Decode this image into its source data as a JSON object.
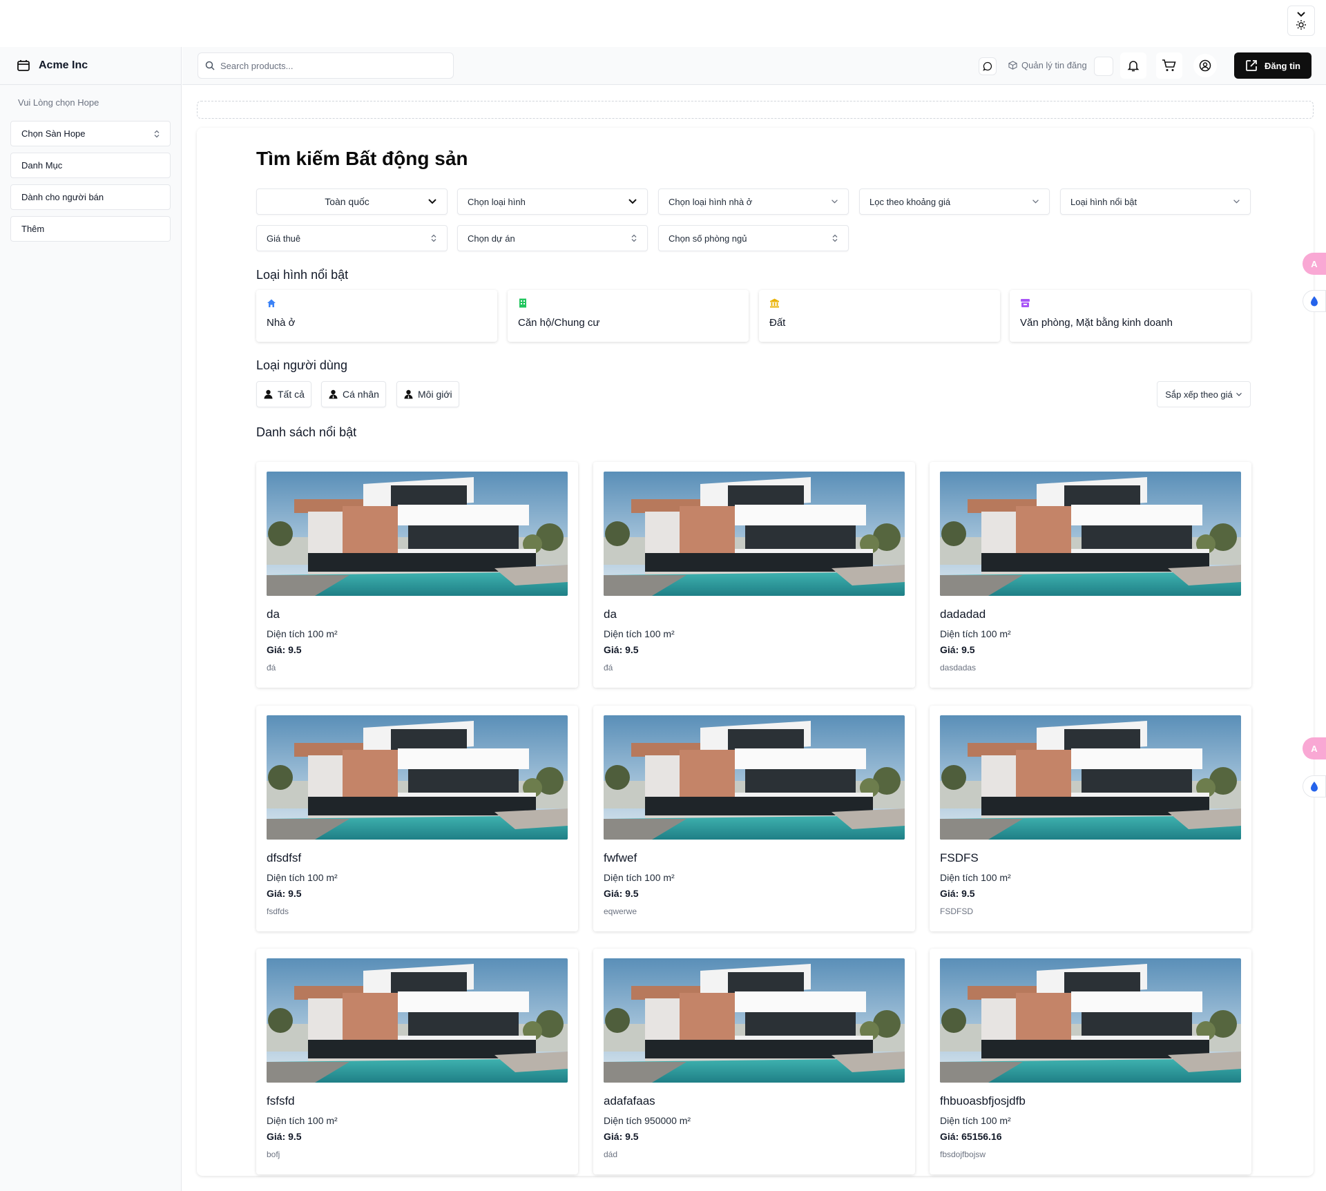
{
  "sidebar": {
    "brand": "Acme Inc",
    "caption": "Vui Lòng chọn Hope",
    "items": [
      {
        "label": "Chọn Sàn Hope"
      },
      {
        "label": "Danh Mục"
      },
      {
        "label": "Dành cho người bán"
      },
      {
        "label": "Thêm"
      }
    ]
  },
  "header": {
    "search_placeholder": "Search products...",
    "manage_listings": "Quản lý tin đăng",
    "post_button": "Đăng tin"
  },
  "main": {
    "title": "Tìm kiếm Bất động sản",
    "filters_row1": [
      {
        "label": "Toàn quốc"
      },
      {
        "label": "Chọn loại hình"
      },
      {
        "label": "Chọn loại hình nhà ở"
      },
      {
        "label": "Lọc theo khoảng giá"
      },
      {
        "label": "Loại hình nổi bật"
      }
    ],
    "filters_row2": [
      {
        "label": "Giá thuê"
      },
      {
        "label": "Chọn dự án"
      },
      {
        "label": "Chọn số phòng ngủ"
      }
    ],
    "featured_types_title": "Loại hình nổi bật",
    "featured_types": [
      {
        "label": "Nhà ở",
        "color": "#3b82f6"
      },
      {
        "label": "Căn hộ/Chung cư",
        "color": "#22c55e"
      },
      {
        "label": "Đất",
        "color": "#eab308"
      },
      {
        "label": "Văn phòng, Mặt bằng kinh doanh",
        "color": "#a855f7"
      }
    ],
    "user_types_title": "Loại người dùng",
    "user_types": [
      {
        "label": "Tất cả"
      },
      {
        "label": "Cá nhân"
      },
      {
        "label": "Môi giới"
      }
    ],
    "sort_label": "Sắp xếp theo giá",
    "listings_title": "Danh sách nổi bật",
    "listings": [
      {
        "title": "da",
        "area": "Diện tích 100 m²",
        "price": "Giá: 9.5",
        "desc": "đá"
      },
      {
        "title": "da",
        "area": "Diện tích 100 m²",
        "price": "Giá: 9.5",
        "desc": "đá"
      },
      {
        "title": "dadadad",
        "area": "Diện tích 100 m²",
        "price": "Giá: 9.5",
        "desc": "dasdadas"
      },
      {
        "title": "dfsdfsf",
        "area": "Diện tích 100 m²",
        "price": "Giá: 9.5",
        "desc": "fsdfds"
      },
      {
        "title": "fwfwef",
        "area": "Diện tích 100 m²",
        "price": "Giá: 9.5",
        "desc": "eqwerwe"
      },
      {
        "title": "FSDFS",
        "area": "Diện tích 100 m²",
        "price": "Giá: 9.5",
        "desc": "FSDFSD"
      },
      {
        "title": "fsfsfd",
        "area": "Diện tích 100 m²",
        "price": "Giá: 9.5",
        "desc": "bofj"
      },
      {
        "title": "adafafaas",
        "area": "Diện tích 950000 m²",
        "price": "Giá: 9.5",
        "desc": "dád"
      },
      {
        "title": "fhbuoasbfjosjdfb",
        "area": "Diện tích 100 m²",
        "price": "Giá: 65156.16",
        "desc": "fbsdojfbojsw"
      }
    ]
  }
}
